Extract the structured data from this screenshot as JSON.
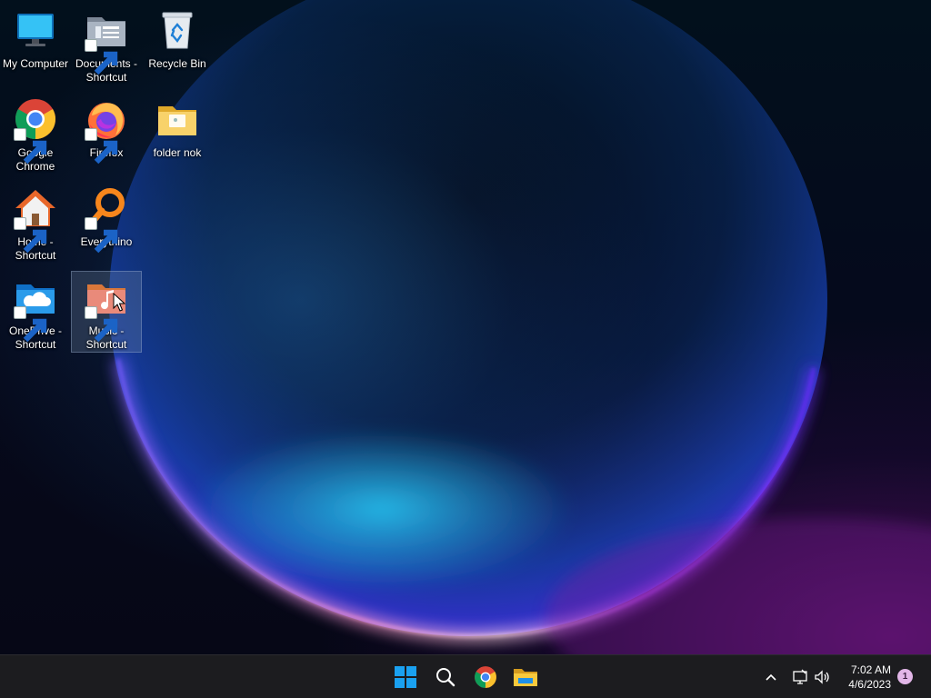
{
  "desktop": {
    "icons": [
      {
        "label": "My Computer"
      },
      {
        "label": "Documents - Shortcut"
      },
      {
        "label": "Recycle Bin"
      },
      {
        "label": "Google Chrome"
      },
      {
        "label": "Firefox"
      },
      {
        "label": "folder nok"
      },
      {
        "label": "Home - Shortcut"
      },
      {
        "label": "Everythino"
      },
      {
        "label": "OneDrive - Shortcut"
      },
      {
        "label": "Music - Shortcut"
      }
    ],
    "selected_icon": "Music - Shortcut"
  },
  "taskbar": {
    "pinned": [
      {
        "name": "start-button-icon"
      },
      {
        "name": "search-icon"
      },
      {
        "name": "chrome-icon"
      },
      {
        "name": "file-explorer-icon"
      }
    ],
    "clock": {
      "time": "7:02 AM",
      "date": "4/6/2023"
    },
    "notification_count": "1"
  },
  "colors": {
    "taskbar_bg": "#1c1c1f",
    "windows_blue": "#1aa1f1",
    "badge": "#e2b6e8"
  }
}
